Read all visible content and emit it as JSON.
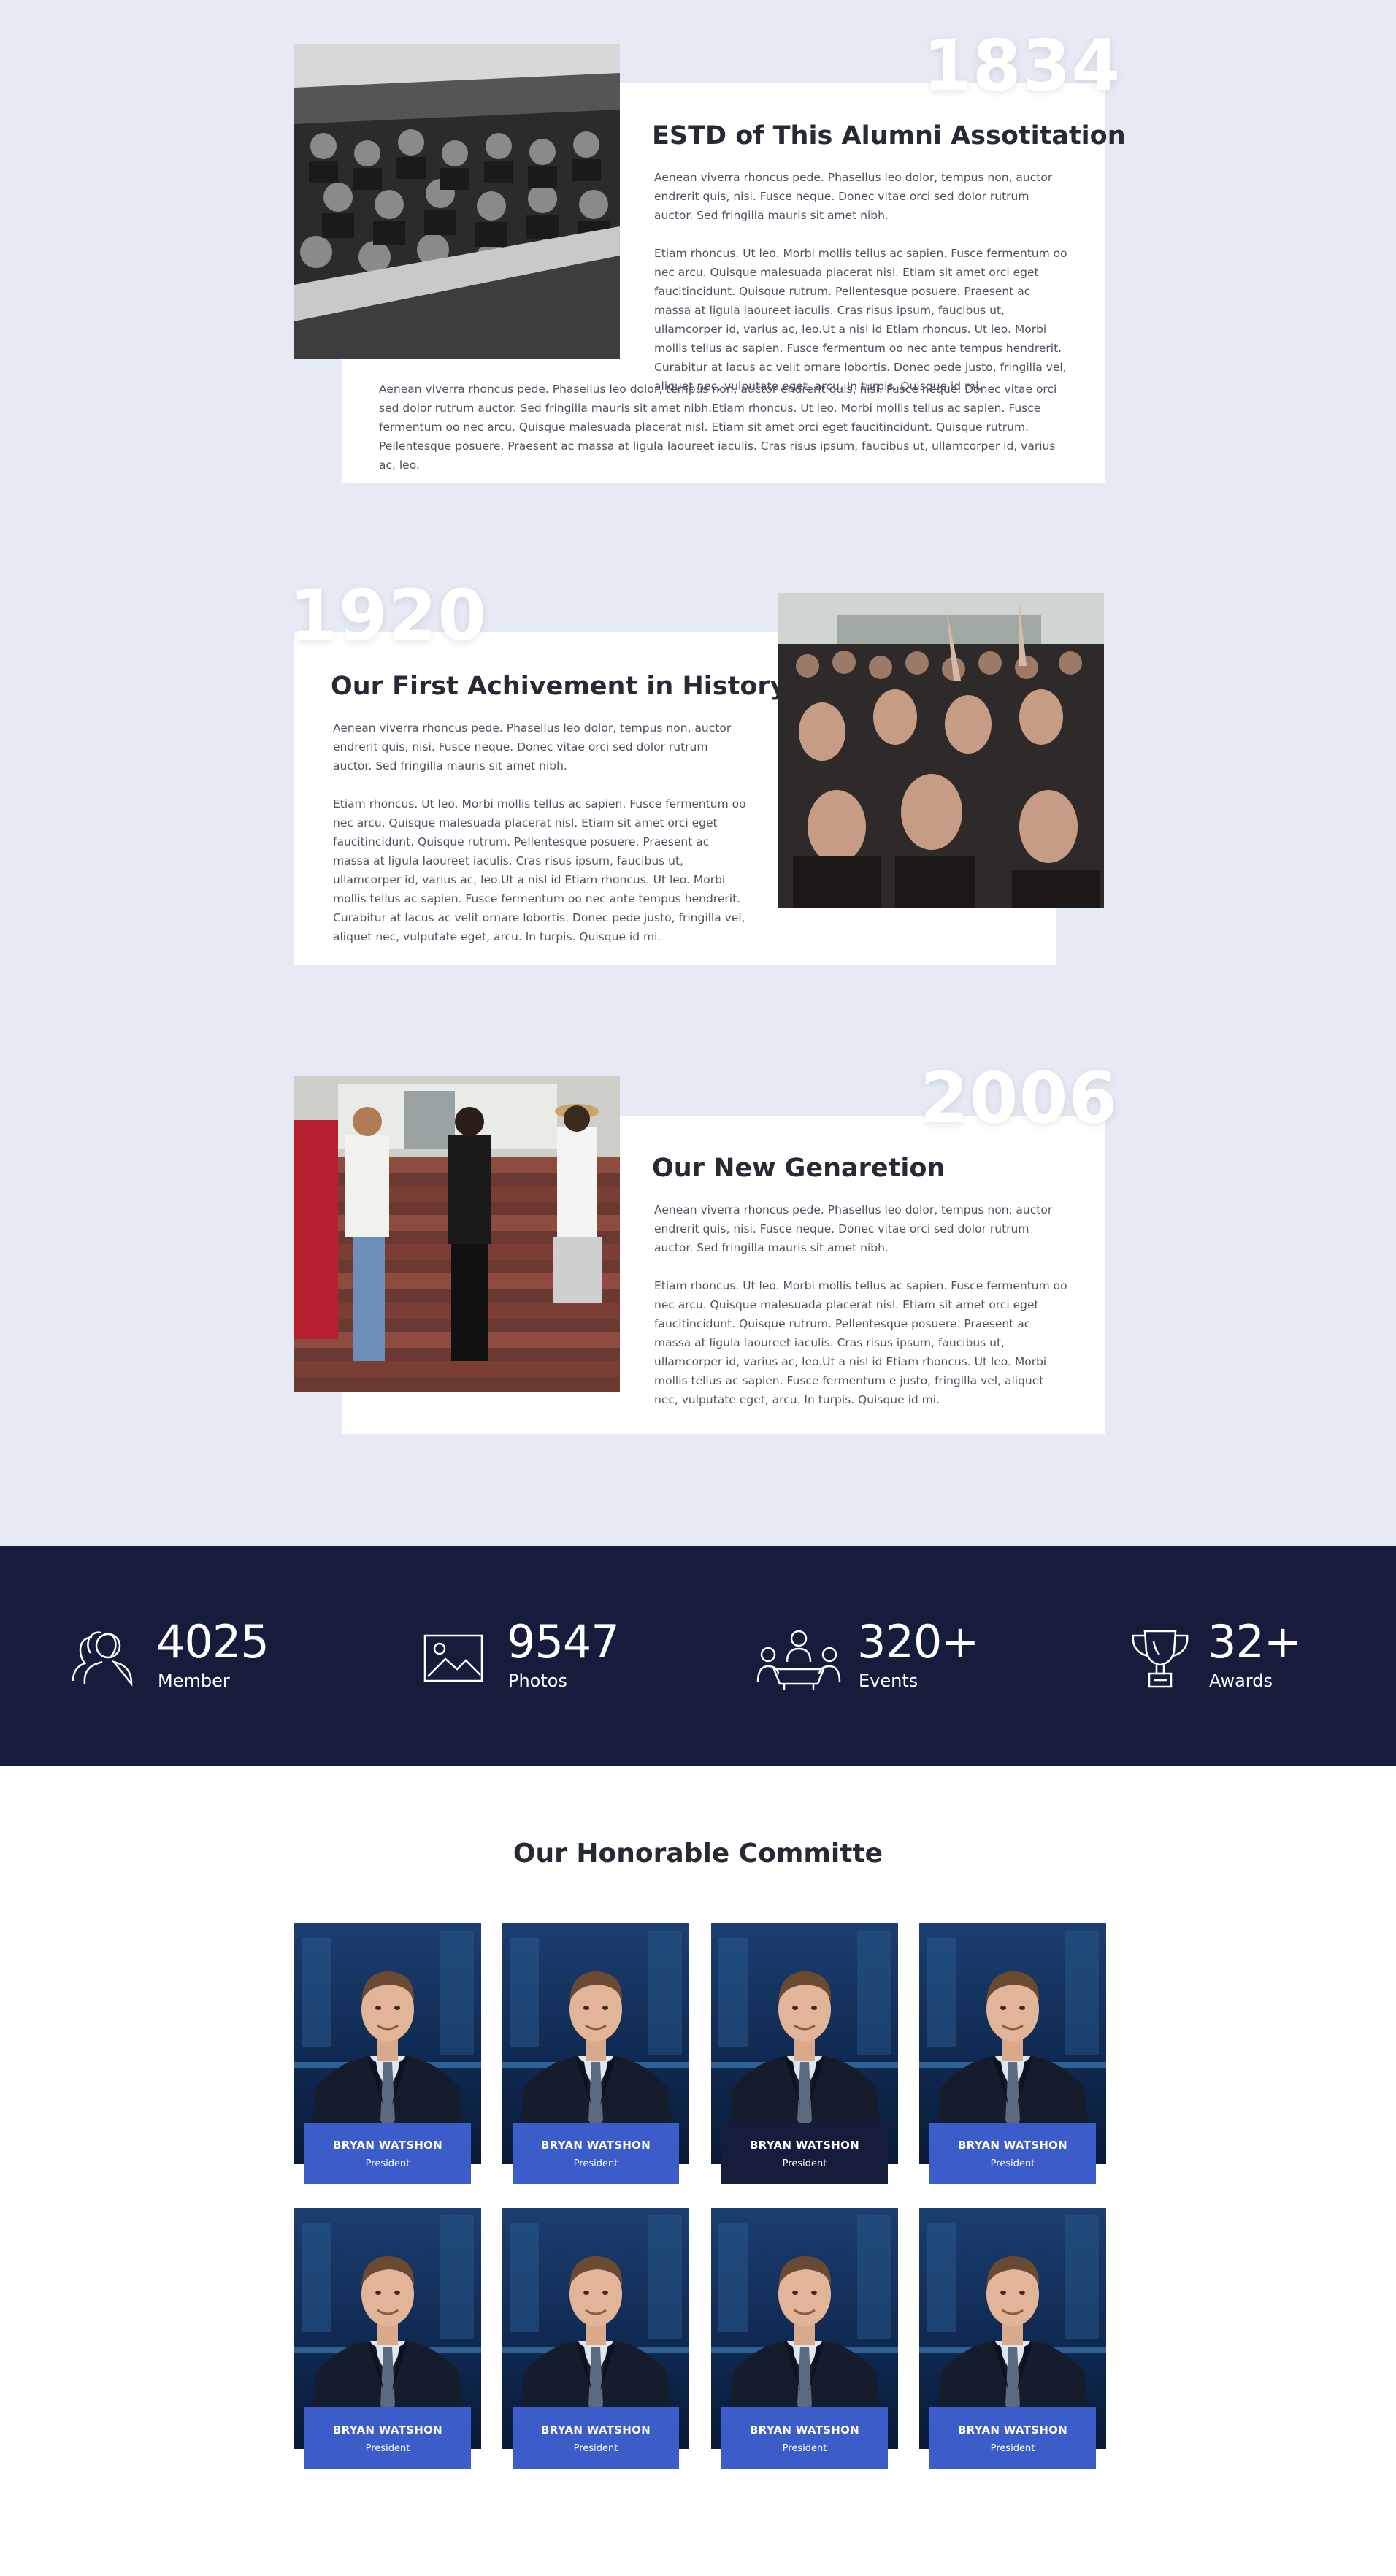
{
  "timeline": [
    {
      "year": "1834",
      "title": "ESTD of This Alumni Assotitation",
      "para1": "Aenean viverra rhoncus pede. Phasellus leo dolor, tempus non, auctor endrerit quis, nisi. Fusce neque. Donec vitae orci sed dolor rutrum auctor. Sed fringilla mauris sit amet nibh.",
      "para2": "Etiam rhoncus. Ut leo. Morbi mollis tellus ac sapien. Fusce fermentum oo nec arcu. Quisque malesuada placerat nisl. Etiam sit amet orci eget faucitincidunt. Quisque rutrum. Pellentesque posuere. Praesent ac massa at ligula laoureet iaculis. Cras risus ipsum, faucibus ut, ullamcorper id, varius ac, leo.Ut a nisl id Etiam rhoncus. Ut leo. Morbi mollis tellus ac sapien. Fusce fermentum oo nec ante tempus hendrerit. Curabitur at lacus ac velit ornare lobortis. Donec pede justo, fringilla vel, aliquet nec, vulputate eget, arcu. In turpis. Quisque id mi.",
      "para3": "Aenean viverra rhoncus pede. Phasellus leo dolor, tempus non, auctor endrerit quis, nisi. Fusce neque. Donec vitae orci sed dolor rutrum auctor. Sed fringilla mauris sit amet nibh.Etiam rhoncus. Ut leo. Morbi mollis tellus ac sapien. Fusce fermentum oo nec arcu. Quisque malesuada placerat nisl. Etiam sit amet orci eget faucitincidunt. Quisque rutrum. Pellentesque posuere. Praesent ac massa at ligula laoureet iaculis. Cras risus ipsum, faucibus ut, ullamcorper id, varius ac, leo."
    },
    {
      "year": "1920",
      "title": "Our First Achivement in History",
      "para1": "Aenean viverra rhoncus pede. Phasellus leo dolor, tempus non, auctor endrerit quis, nisi. Fusce neque. Donec vitae orci sed dolor rutrum auctor. Sed fringilla mauris sit amet nibh.",
      "para2": "Etiam rhoncus. Ut leo. Morbi mollis tellus ac sapien. Fusce fermentum oo nec arcu. Quisque malesuada placerat nisl. Etiam sit amet orci eget faucitincidunt. Quisque rutrum. Pellentesque posuere. Praesent ac massa at ligula laoureet iaculis. Cras risus ipsum, faucibus ut, ullamcorper id, varius ac, leo.Ut a nisl id Etiam rhoncus. Ut leo. Morbi mollis tellus ac sapien. Fusce fermentum oo nec ante tempus hendrerit. Curabitur at lacus ac velit ornare lobortis. Donec pede justo, fringilla vel, aliquet nec, vulputate eget, arcu. In turpis. Quisque id mi."
    },
    {
      "year": "2006",
      "title": "Our New Genaretion",
      "para1": "Aenean viverra rhoncus pede. Phasellus leo dolor, tempus non, auctor endrerit quis, nisi. Fusce neque. Donec vitae orci sed dolor rutrum auctor. Sed fringilla mauris sit amet nibh.",
      "para2": "Etiam rhoncus. Ut leo. Morbi mollis tellus ac sapien. Fusce fermentum oo nec arcu. Quisque malesuada placerat nisl. Etiam sit amet orci eget faucitincidunt. Quisque rutrum. Pellentesque posuere. Praesent ac massa at ligula laoureet iaculis. Cras risus ipsum, faucibus ut, ullamcorper id, varius ac, leo.Ut a nisl id Etiam rhoncus. Ut leo. Morbi mollis tellus ac sapien. Fusce fermentum e justo, fringilla vel, aliquet nec, vulputate eget, arcu. In turpis. Quisque id mi."
    }
  ],
  "stats": [
    {
      "icon": "members-icon",
      "value": "4025",
      "label": "Member"
    },
    {
      "icon": "photo-icon",
      "value": "9547",
      "label": "Photos"
    },
    {
      "icon": "meeting-icon",
      "value": "320+",
      "label": "Events"
    },
    {
      "icon": "trophy-icon",
      "value": "32+",
      "label": "Awards"
    }
  ],
  "committee": {
    "title": "Our Honorable Committe",
    "members": [
      {
        "name": "BRYAN WATSHON",
        "role": "President"
      },
      {
        "name": "BRYAN WATSHON",
        "role": "President"
      },
      {
        "name": "BRYAN WATSHON",
        "role": "President"
      },
      {
        "name": "BRYAN WATSHON",
        "role": "President"
      },
      {
        "name": "BRYAN WATSHON",
        "role": "President"
      },
      {
        "name": "BRYAN WATSHON",
        "role": "President"
      },
      {
        "name": "BRYAN WATSHON",
        "role": "President"
      },
      {
        "name": "BRYAN WATSHON",
        "role": "President"
      }
    ]
  },
  "colors": {
    "page_bg": "#e6eaf4",
    "stats_bg": "#161d3c",
    "accent": "#3b5cc9",
    "title": "#262a33"
  }
}
